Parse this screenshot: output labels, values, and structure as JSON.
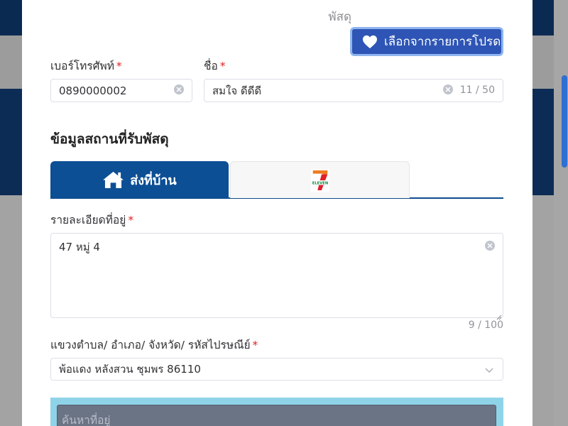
{
  "dialog": {
    "parcel_label": "พัสดุ",
    "favorites_button_label": "เลือกจากรายการโปรด"
  },
  "phone": {
    "label": "เบอร์โทรศัพท์",
    "value": "0890000002"
  },
  "name": {
    "label": "ชื่อ",
    "value": "สมใจ ดีดีดี",
    "counter": "11 / 50"
  },
  "pickup": {
    "section_title": "ข้อมูลสถานที่รับพัสดุ",
    "tab_home_label": "ส่งที่บ้าน",
    "tab_7eleven_logo_text": "ELEVEN"
  },
  "address": {
    "label": "รายละเอียดที่อยู่",
    "value": "47 หมู่ 4",
    "counter": "9 / 100"
  },
  "region": {
    "label": "แขวงตำบล/ อำเภอ/ จังหวัด/ รหัสไปรษณีย์",
    "value": "พ้อแดง หลังสวน ชุมพร 86110"
  },
  "search": {
    "placeholder": "ค้นหาที่อยู่"
  },
  "required_mark": "*",
  "colors": {
    "primary": "#0c4f94",
    "button": "#2e55b5",
    "required": "#e02020",
    "search_bg": "#8fd3e8"
  }
}
